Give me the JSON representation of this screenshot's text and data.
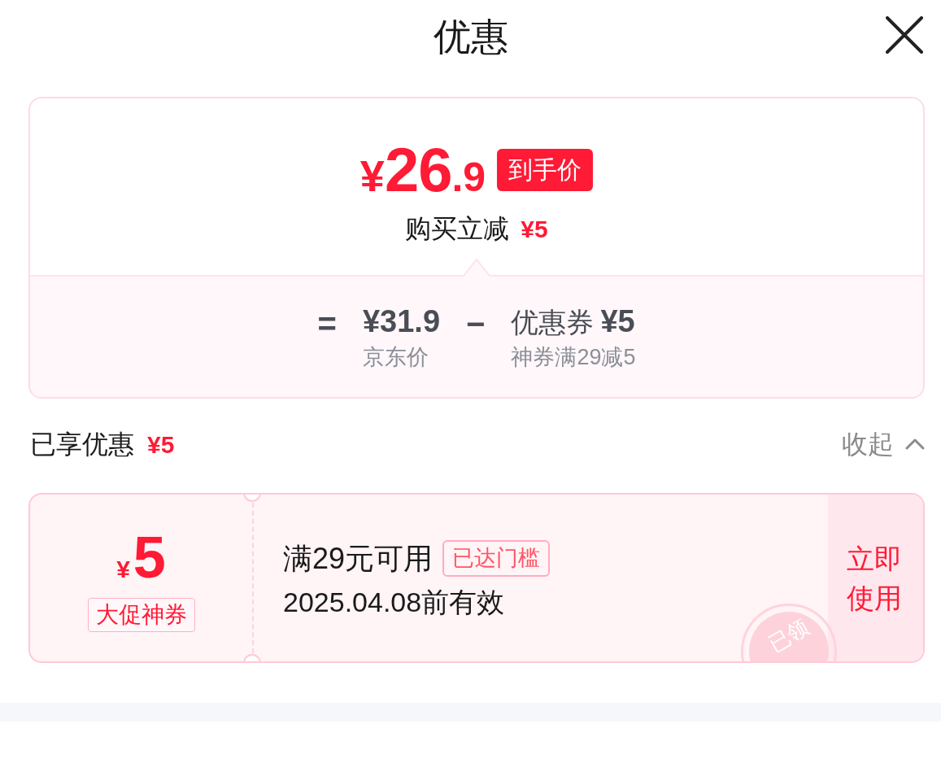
{
  "header": {
    "title": "优惠"
  },
  "price_card": {
    "final_price": {
      "currency": "¥",
      "integer": "26",
      "decimal": ".9"
    },
    "price_badge": "到手价",
    "saving_label": "购买立减",
    "saving_amount": "¥5",
    "breakdown": [
      {
        "kind": "operator",
        "symbol": "="
      },
      {
        "kind": "term",
        "value": "¥31.9",
        "caption": "京东价"
      },
      {
        "kind": "operator",
        "symbol": "−"
      },
      {
        "kind": "term",
        "label": "优惠券",
        "value": "¥5",
        "caption": "神券满29减5"
      }
    ]
  },
  "applied": {
    "label": "已享优惠",
    "amount": "¥5",
    "toggle": "收起",
    "expanded": true
  },
  "coupons": [
    {
      "currency": "¥",
      "amount": "5",
      "tag": "大促神券",
      "condition": "满29元可用",
      "status_tag": "已达门槛",
      "validity": "2025.04.08前有效",
      "action": "立即使用",
      "stamp": "已领"
    }
  ]
}
